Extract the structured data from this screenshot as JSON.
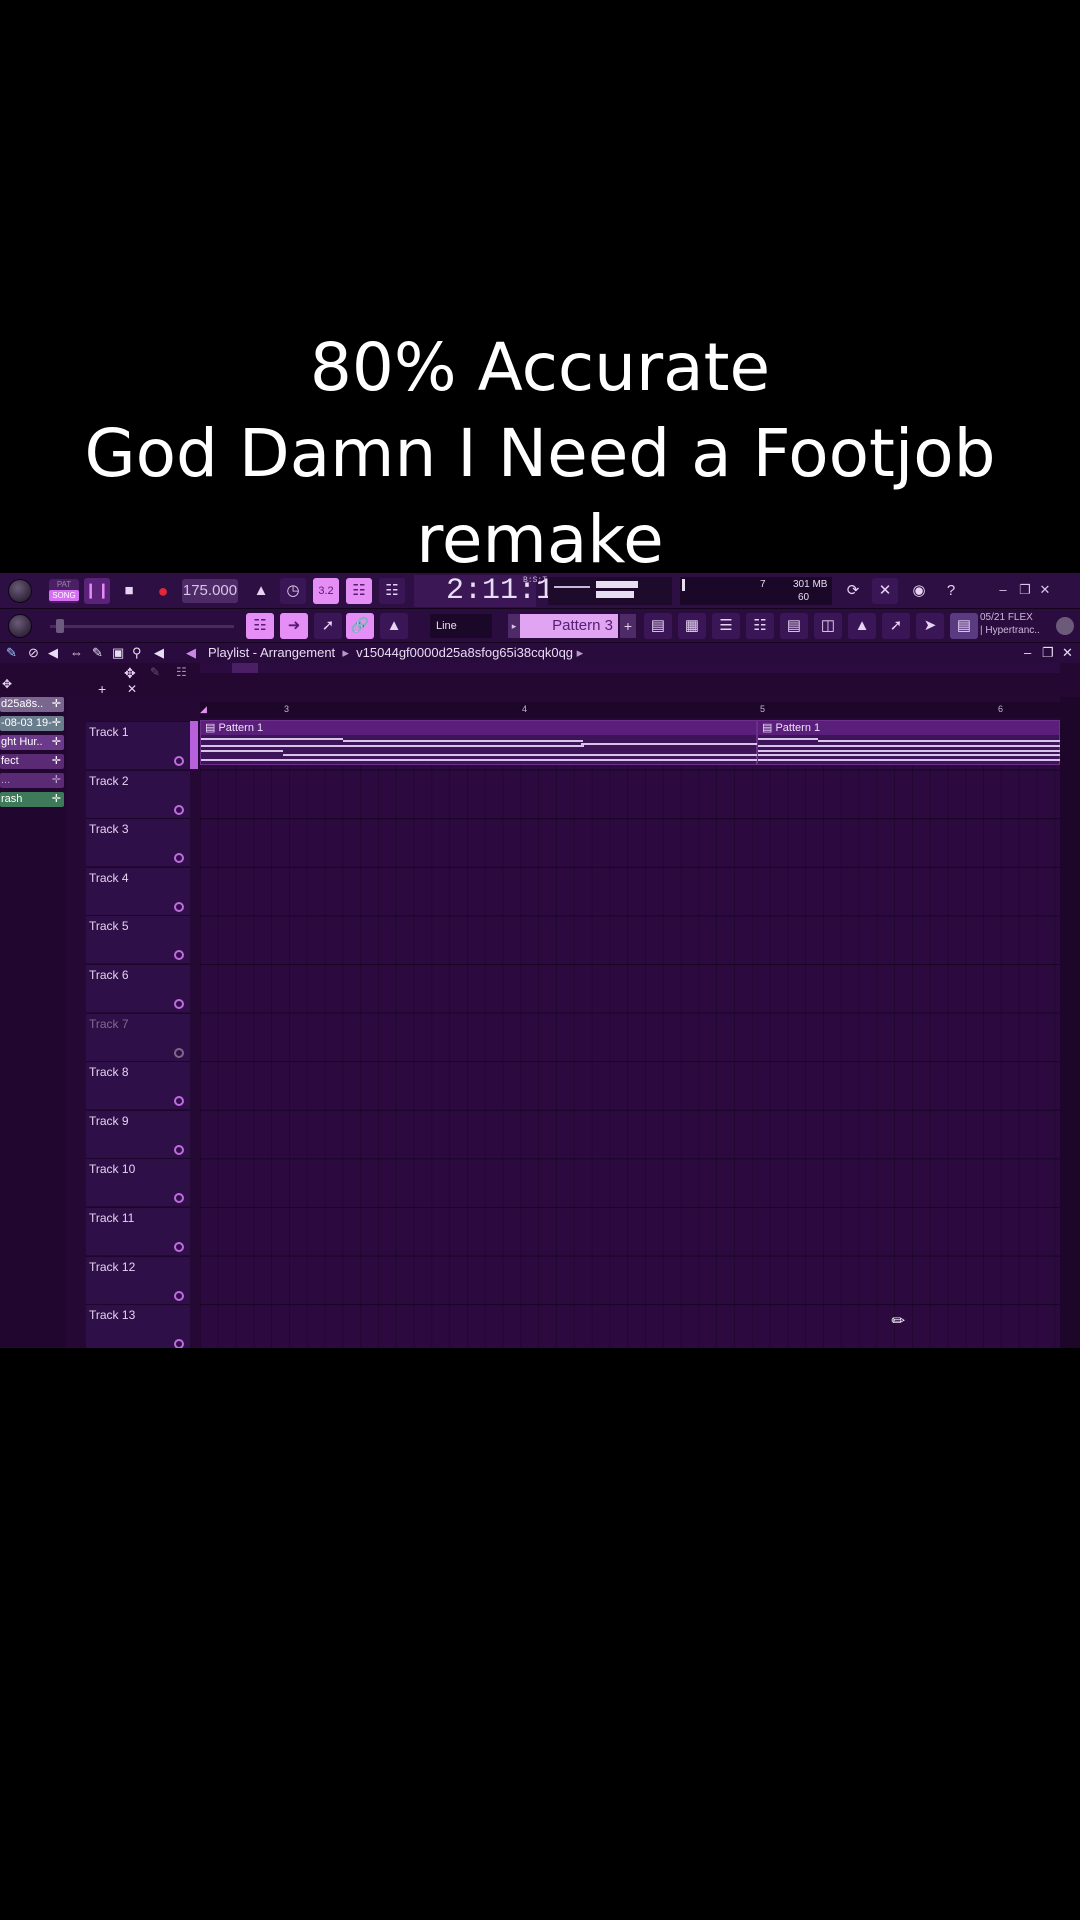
{
  "caption": {
    "line1": "80% Accurate",
    "line2": "God Damn I Need a Footjob",
    "line3": "remake"
  },
  "toolbar": {
    "pat_label": "PAT",
    "song_label": "SONG",
    "tempo": "175.000",
    "time": "2:11:10",
    "time_unit": "B:S:T",
    "cpu_value": "7",
    "memory": "301 MB",
    "polyphony": "60",
    "snap_mode": "Line",
    "pattern_name": "Pattern 3",
    "pattern_add": "+",
    "news_date": "05/21",
    "news_title": "FLEX",
    "news_subtitle": "| Hypertranc..",
    "help_label": "?"
  },
  "playlist": {
    "title": "Playlist - Arrangement",
    "path": "v15044gf0000d25a8sfog65i38cqk0qg",
    "path_arrow": "▸",
    "ruler": [
      "3",
      "4",
      "5",
      "6"
    ],
    "clips": [
      {
        "label": "Pattern 1"
      },
      {
        "label": "Pattern 1"
      }
    ],
    "tracks": [
      "Track 1",
      "Track 2",
      "Track 3",
      "Track 4",
      "Track 5",
      "Track 6",
      "Track 7",
      "Track 8",
      "Track 9",
      "Track 10",
      "Track 11",
      "Track 12",
      "Track 13"
    ]
  },
  "picker": {
    "items": [
      "d25a8s..",
      "-08-03 19-",
      "ght Hur..",
      "fect",
      "...",
      "rash"
    ]
  },
  "colors": {
    "background": "#000000",
    "accent": "#e58ef5",
    "panel": "#2e0f44",
    "grid": "#2c0a40"
  },
  "icons": {
    "master-volume": "knob-icon",
    "play": "pause-icon",
    "stop": "stop-icon",
    "record": "record-icon",
    "metronome": "metronome-icon",
    "close": "close-icon"
  }
}
